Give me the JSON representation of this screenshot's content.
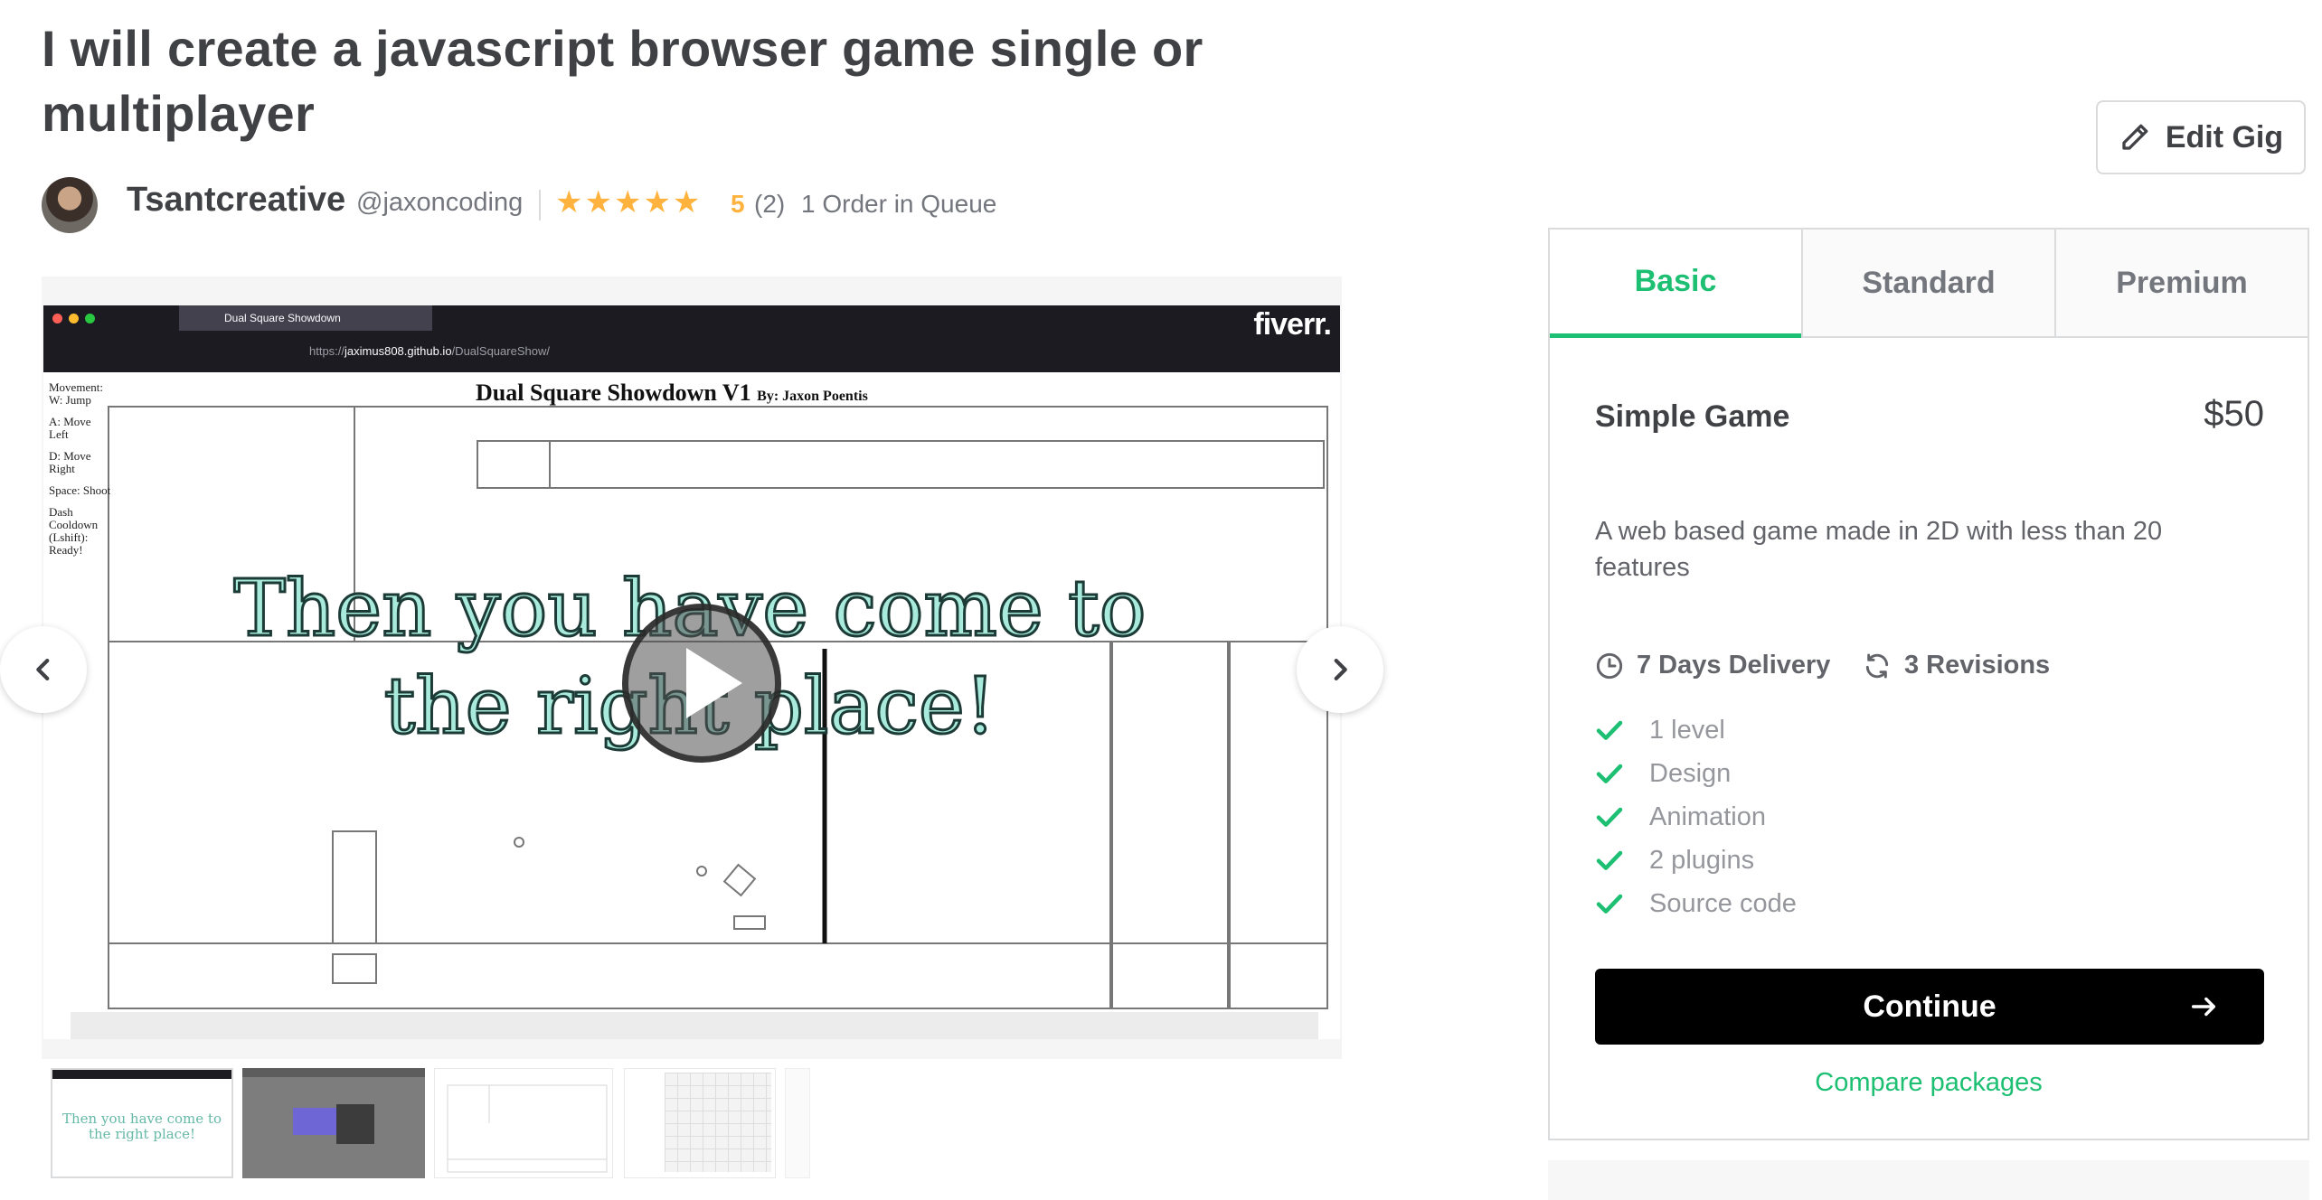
{
  "gig": {
    "title": "I will create a javascript browser game single or multiplayer"
  },
  "seller": {
    "name": "Tsantcreative",
    "handle": "@jaxoncoding",
    "stars": "★★★★★",
    "rating": "5",
    "rating_count": "(2)",
    "queue": "1 Order in Queue"
  },
  "edit": {
    "label": "Edit Gig"
  },
  "media": {
    "browser_tab": "Dual Square Showdown",
    "url_prefix": "https://",
    "url_host": "jaximus808.github.io",
    "url_path": "/DualSquareShow/",
    "brand": "fiverr.",
    "game_title": "Dual Square Showdown V1",
    "game_byline": "By: Jaxon Poentis",
    "controls": [
      "Movement: W: Jump",
      "A: Move Left",
      "D: Move Right",
      "Space: Shoot",
      "Dash Cooldown (Lshift): Ready!"
    ],
    "overlay_line1": "Then you have come to",
    "overlay_line2": "the right place!",
    "thumb1_text": "Then you have come to the right place!"
  },
  "packages": {
    "tabs": [
      "Basic",
      "Standard",
      "Premium"
    ],
    "active_tab": "Basic",
    "name": "Simple Game",
    "price": "$50",
    "description": "A web based game made in 2D with less than 20 features",
    "delivery": "7 Days Delivery",
    "revisions": "3 Revisions",
    "features": [
      "1 level",
      "Design",
      "Animation",
      "2 plugins",
      "Source code"
    ],
    "continue_label": "Continue",
    "compare_label": "Compare packages"
  },
  "colors": {
    "accent_green": "#1dbf73",
    "star_yellow": "#ffb33e",
    "text_dark": "#404145",
    "text_muted": "#74767e"
  }
}
